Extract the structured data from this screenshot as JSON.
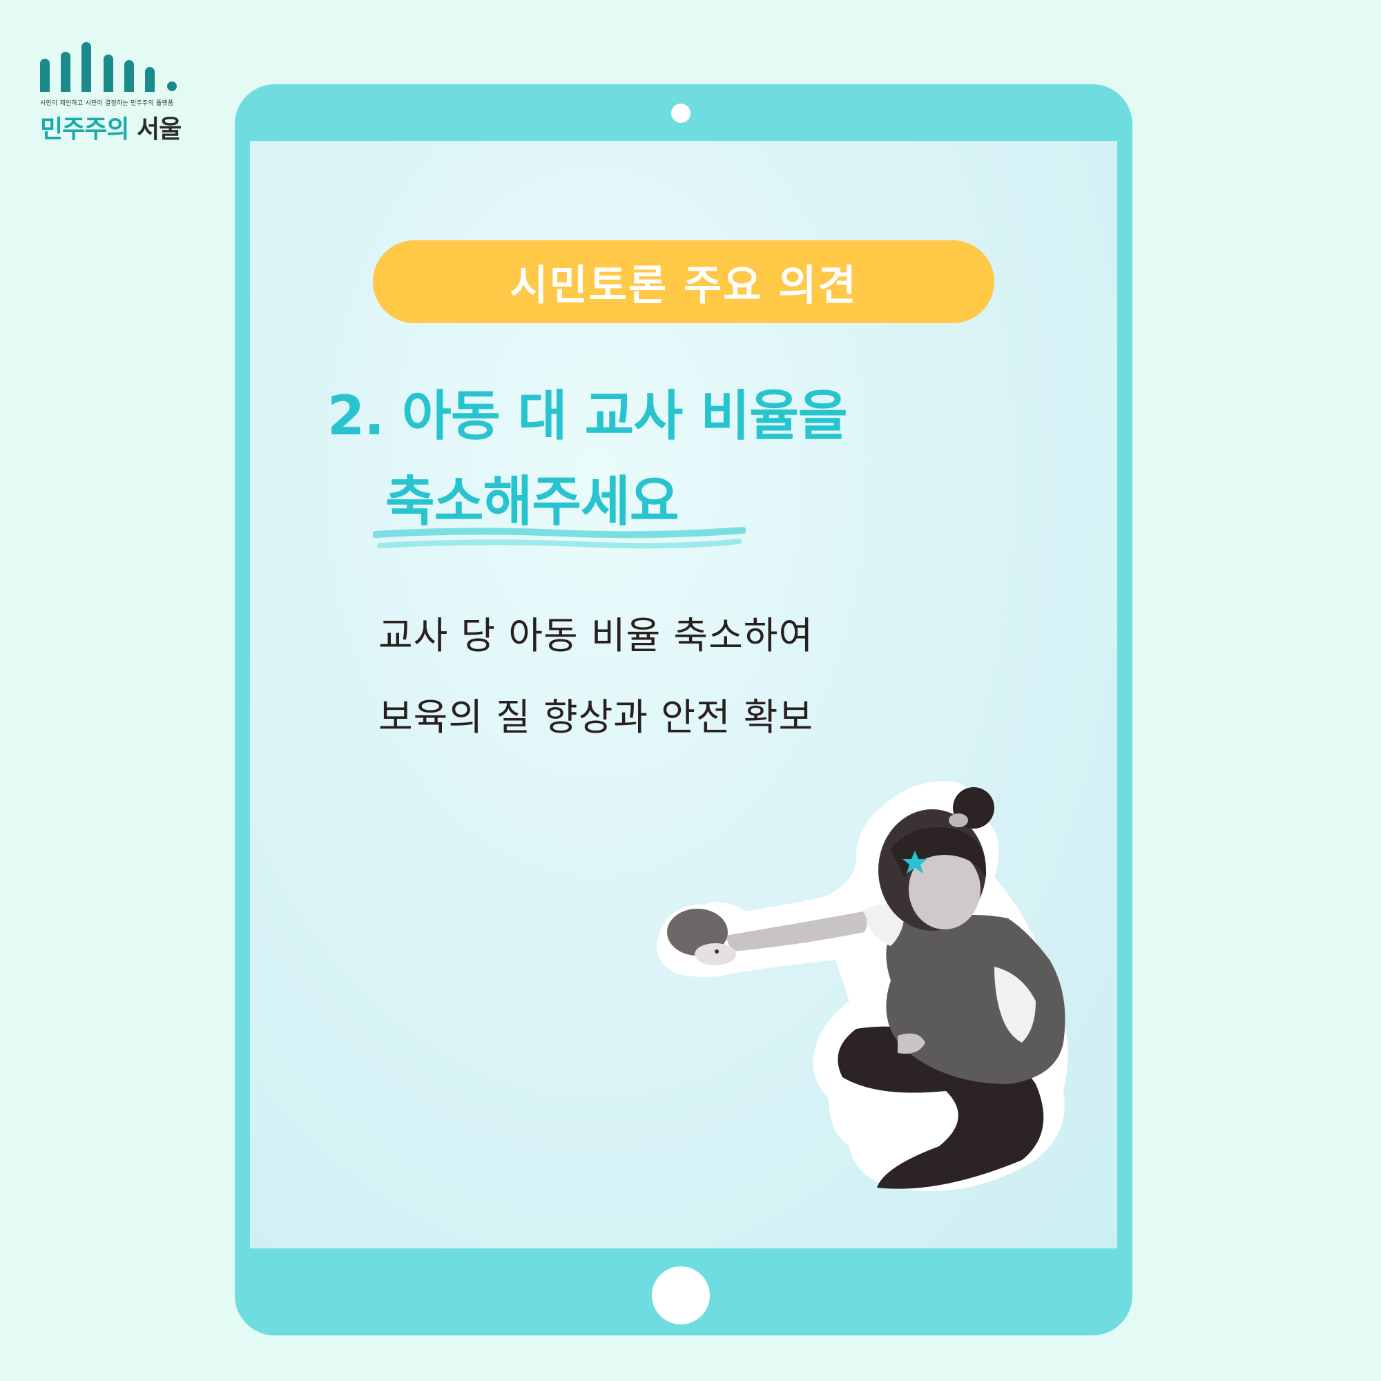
{
  "logo": {
    "tagline": "시민이 제안하고 시민이 결정하는 민주주의 플랫폼",
    "name_part1": "민주주의",
    "name_part2": "서울"
  },
  "tablet": {
    "badge_label": "시민토론 주요 의견",
    "heading_line1": "2. 아동 대 교사 비율을",
    "heading_line2": "축소해주세요",
    "body_line1": "교사 당 아동 비율 축소하여",
    "body_line2": "보육의 질 향상과 안전 확보"
  },
  "colors": {
    "background": "#e4fbf5",
    "tablet_frame": "#6fdcdf",
    "badge": "#ffc846",
    "heading": "#27c3cf",
    "body_text": "#2a1f1f",
    "logo_teal": "#1a8a8a"
  },
  "icons": {
    "logo": "bar-graph-logo-icon",
    "photo": "seated-teacher-holding-toy-photo"
  }
}
